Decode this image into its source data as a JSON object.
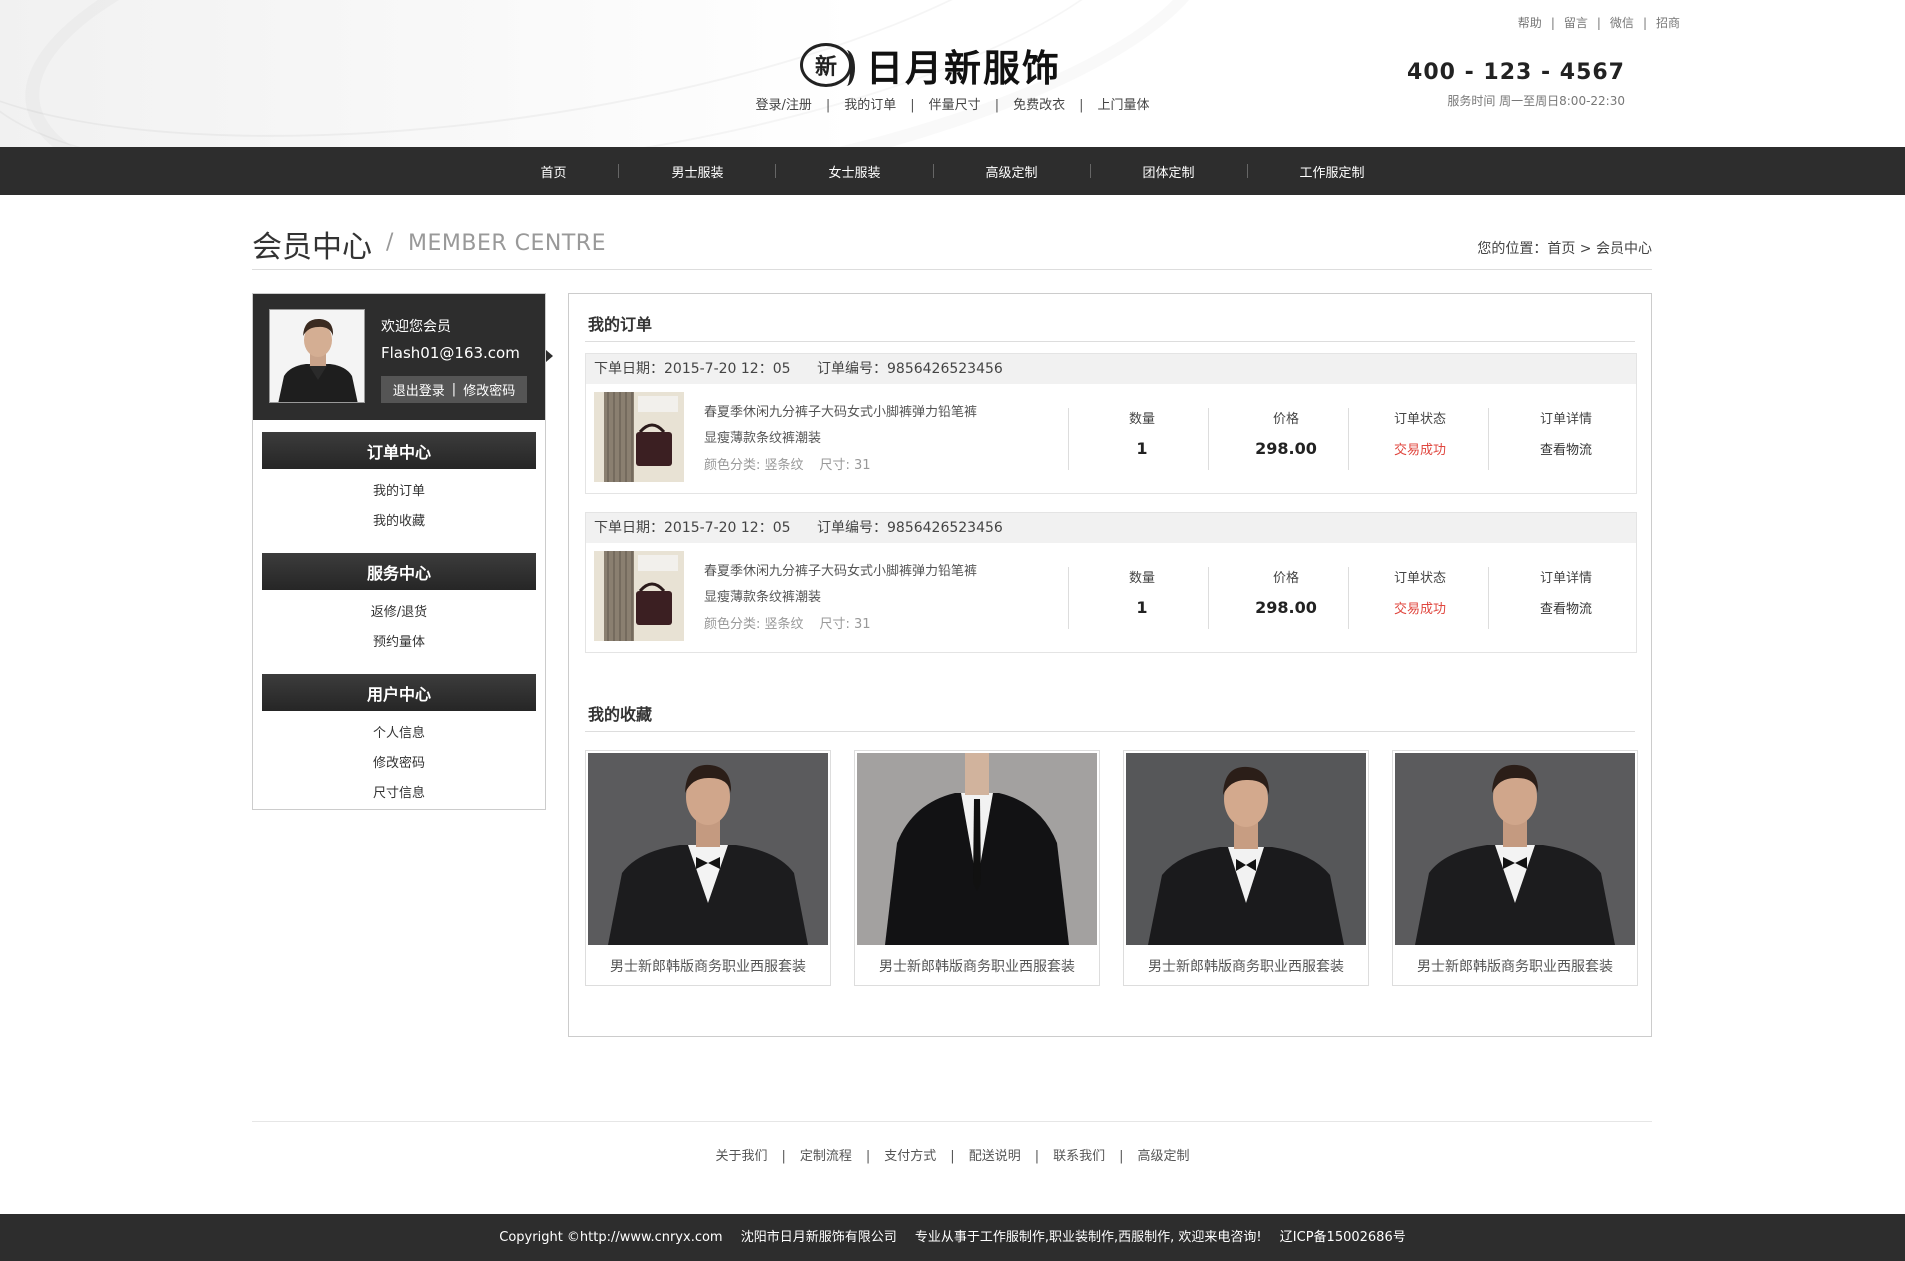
{
  "brand": {
    "seal_char": "新",
    "name": "日月新服饰"
  },
  "header_links": [
    "登录/注册",
    "我的订单",
    "伴量尺寸",
    "免费改衣",
    "上门量体"
  ],
  "util_links": [
    "帮助",
    "留言",
    "微信",
    "招商"
  ],
  "contact": {
    "phone": "400 - 123 - 4567",
    "hours": "服务时间 周一至周日8:00-22:30"
  },
  "nav": [
    "首页",
    "男士服装",
    "女士服装",
    "高级定制",
    "团体定制",
    "工作服定制"
  ],
  "page_title": {
    "cn": "会员中心",
    "slash": "/",
    "en": "MEMBER CENTRE",
    "breadcrumb": "您的位置：首页 > 会员中心"
  },
  "member": {
    "welcome": "欢迎您会员",
    "email": "Flash01@163.com",
    "logout": "退出登录",
    "change_password": "修改密码",
    "action_sep": "|"
  },
  "sidebar": {
    "groups": [
      {
        "title": "订单中心",
        "items": [
          "我的订单",
          "我的收藏"
        ]
      },
      {
        "title": "服务中心",
        "items": [
          "返修/退货",
          "预约量体"
        ]
      },
      {
        "title": "用户中心",
        "items": [
          "个人信息",
          "修改密码",
          "尺寸信息"
        ]
      }
    ]
  },
  "orders_section": {
    "title": "我的订单",
    "col_labels": {
      "qty": "数量",
      "price": "价格",
      "status": "订单状态",
      "detail": "订单详情"
    },
    "orders": [
      {
        "date": "下单日期：2015-7-20 12：05",
        "number": "订单编号：9856426523456",
        "product_line1": "春夏季休闲九分裤子大码女式小脚裤弹力铅笔裤",
        "product_line2": "显瘦薄款条纹裤潮装",
        "color": "颜色分类: 竖条纹",
        "size": "尺寸: 31",
        "qty": "1",
        "price": "298.00",
        "status": "交易成功",
        "detail": "查看物流"
      },
      {
        "date": "下单日期：2015-7-20 12：05",
        "number": "订单编号：9856426523456",
        "product_line1": "春夏季休闲九分裤子大码女式小脚裤弹力铅笔裤",
        "product_line2": "显瘦薄款条纹裤潮装",
        "color": "颜色分类: 竖条纹",
        "size": "尺寸: 31",
        "qty": "1",
        "price": "298.00",
        "status": "交易成功",
        "detail": "查看物流"
      }
    ]
  },
  "favorites_section": {
    "title": "我的收藏",
    "items": [
      {
        "caption": "男士新郎韩版商务职业西服套装"
      },
      {
        "caption": "男士新郎韩版商务职业西服套装"
      },
      {
        "caption": "男士新郎韩版商务职业西服套装"
      },
      {
        "caption": "男士新郎韩版商务职业西服套装"
      }
    ]
  },
  "footer_links": [
    "关于我们",
    "定制流程",
    "支付方式",
    "配送说明",
    "联系我们",
    "高级定制"
  ],
  "copyright": {
    "site": "Copyright ©http://www.cnryx.com",
    "company": "沈阳市日月新服饰有限公司",
    "desc": "专业从事于工作服制作,职业装制作,西服制作, 欢迎来电咨询!",
    "icp": "辽ICP备15002686号"
  },
  "colors": {
    "dark_bar": "#2d2d2d",
    "status_success": "#e0463e"
  },
  "icons": {
    "arrow": "triangle-right-icon"
  }
}
